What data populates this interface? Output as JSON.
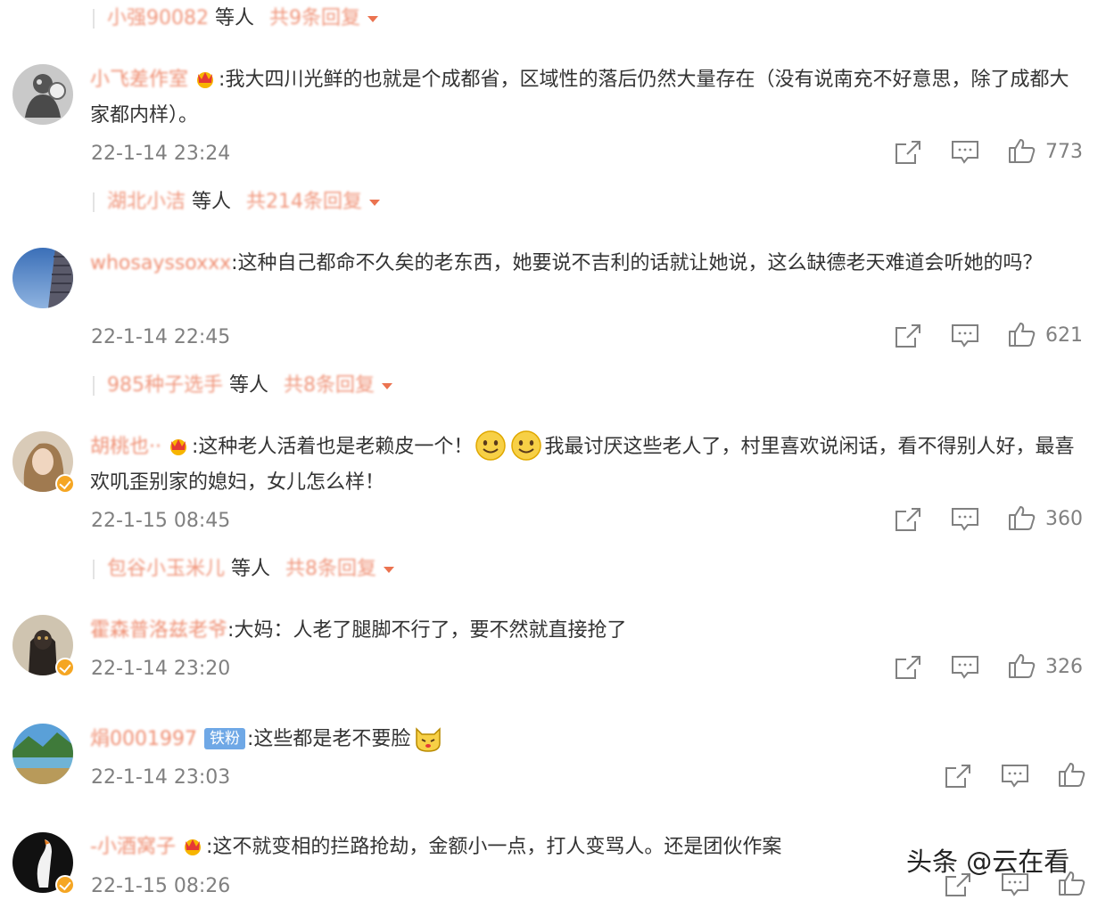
{
  "reply_summaries": [
    {
      "user": "小强90082",
      "others": "等人",
      "count": "共9条回复"
    },
    {
      "user": "湖北小洁",
      "others": "等人",
      "count": "共214条回复"
    },
    {
      "user": "985种子选手",
      "others": "等人",
      "count": "共8条回复"
    },
    {
      "user": "包谷小玉米儿",
      "others": "等人",
      "count": "共8条回复"
    }
  ],
  "comments": [
    {
      "user": "小飞差作室",
      "text": "我大四川光鲜的也就是个成都省，区域性的落后仍然大量存在（没有说南充不好意思，除了成都大家都内样）。",
      "time": "22-1-14 23:24",
      "likes": "773"
    },
    {
      "user": "whosayssoxxx",
      "text": "这种自己都命不久矣的老东西，她要说不吉利的话就让她说，这么缺德老天难道会听她的吗？",
      "time": "22-1-14 22:45",
      "likes": "621"
    },
    {
      "user": "胡桃也··",
      "text_a": "这种老人活着也是老赖皮一个！",
      "text_b": "我最讨厌这些老人了，村里喜欢说闲话，看不得别人好，最喜欢叽歪别家的媳妇，女儿怎么样！",
      "time": "22-1-15 08:45",
      "likes": "360"
    },
    {
      "user": "霍森普洛兹老爷",
      "text": "大妈：人老了腿脚不行了，要不然就直接抢了",
      "time": "22-1-14 23:20",
      "likes": "326"
    },
    {
      "user": "焆0001997",
      "badge": "铁粉",
      "text": "这些都是老不要脸",
      "time": "22-1-14 23:03",
      "likes": ""
    },
    {
      "user": "-小酒窝子",
      "text": "这不就变相的拦路抢劫，金额小一点，打人变骂人。还是团伙作案",
      "time": "22-1-15 08:26",
      "likes": ""
    }
  ],
  "watermark": "头条 @云在看",
  "colors": {
    "username": "#eb7350",
    "text": "#333333",
    "meta": "#808080",
    "badge_v": "#f5a623",
    "fan_badge": "#6fa8e6"
  },
  "icons": {
    "share": "share-icon",
    "comment": "comment-icon",
    "like": "thumbs-up-icon",
    "caret": "caret-down-icon",
    "crown": "crown-icon",
    "verified": "verified-badge-icon"
  }
}
